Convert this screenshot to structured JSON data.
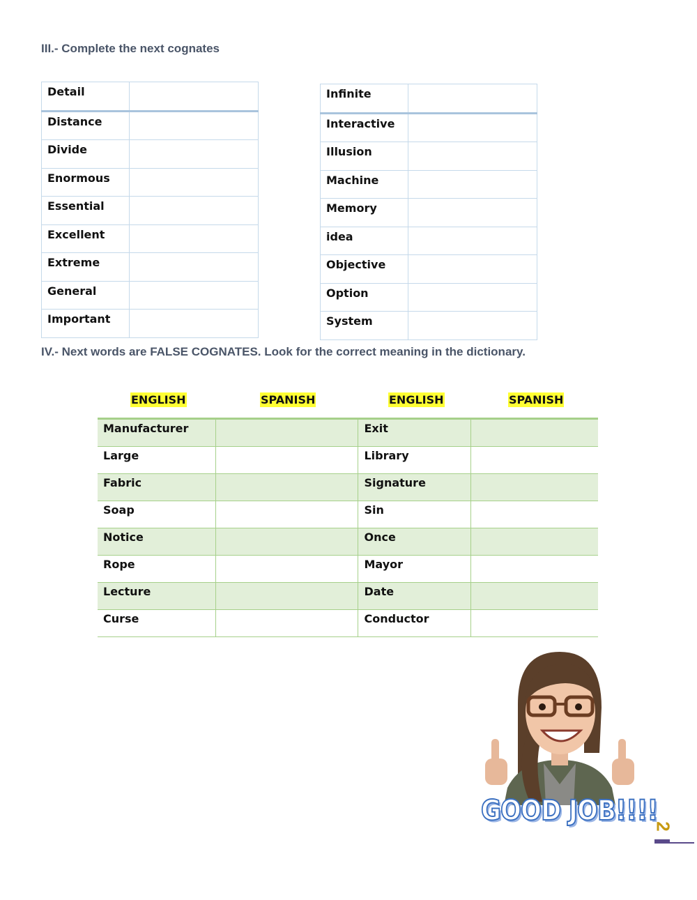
{
  "section3": {
    "heading": "III.- Complete the next cognates",
    "left_words": [
      "Detail",
      "Distance",
      "Divide",
      "Enormous",
      "Essential",
      "Excellent",
      "Extreme",
      "General",
      "Important"
    ],
    "right_words": [
      "Infinite",
      "Interactive",
      "Illusion",
      "Machine",
      "Memory",
      "idea",
      "Objective",
      "Option",
      "System"
    ]
  },
  "section4": {
    "heading": "IV.- Next words are FALSE COGNATES. Look for the correct meaning in the dictionary.",
    "headers": [
      "ENGLISH",
      "SPANISH",
      "ENGLISH",
      "SPANISH"
    ],
    "header_highlight": "#ffff33",
    "rows": [
      {
        "left": "Manufacturer",
        "right": "Exit"
      },
      {
        "left": "Large",
        "right": "Library"
      },
      {
        "left": "Fabric",
        "right": "Signature"
      },
      {
        "left": "Soap",
        "right": "Sin"
      },
      {
        "left": "Notice",
        "right": "Once"
      },
      {
        "left": "Rope",
        "right": "Mayor"
      },
      {
        "left": "Lecture",
        "right": "Date"
      },
      {
        "left": "Curse",
        "right": "Conductor"
      }
    ]
  },
  "sticker": {
    "text": "GOOD JOB!!!!",
    "image": "avatar-thumbs-up"
  },
  "page_number": "2"
}
